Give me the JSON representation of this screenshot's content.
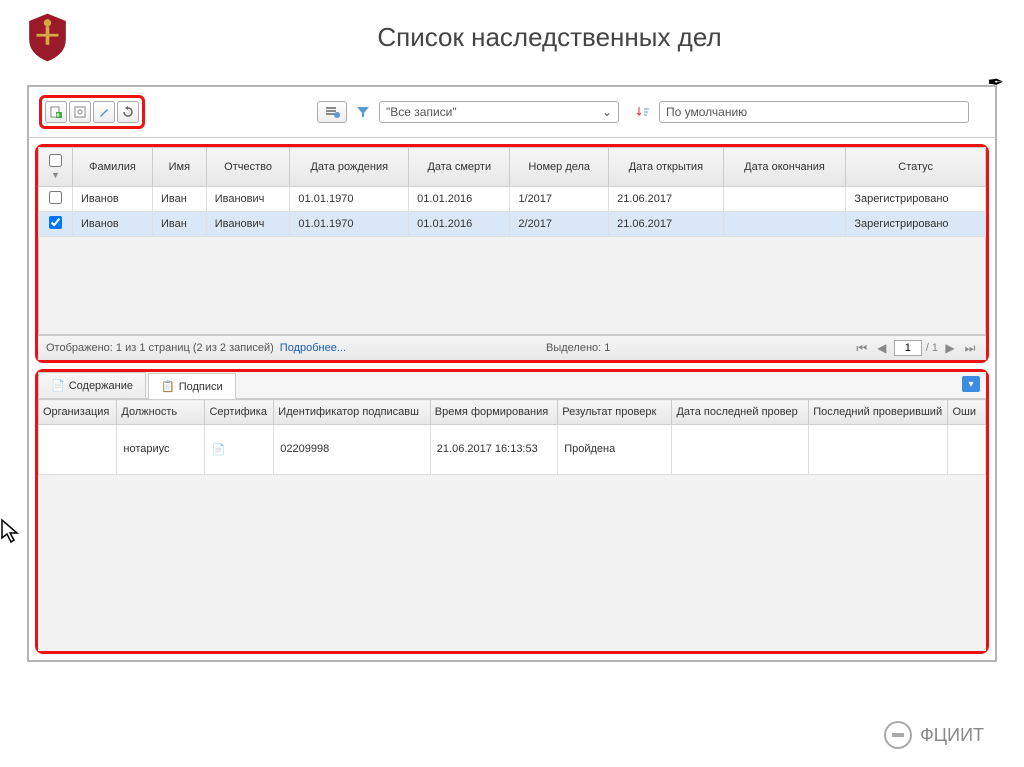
{
  "page_title": "Список наследственных дел",
  "toolbar": {
    "filter_label": "\"Все записи\"",
    "sort_label": "По умолчанию"
  },
  "columns": [
    "Фамилия",
    "Имя",
    "Отчество",
    "Дата рождения",
    "Дата смерти",
    "Номер дела",
    "Дата открытия",
    "Дата окончания",
    "Статус"
  ],
  "rows": [
    {
      "checked": false,
      "cells": [
        "Иванов",
        "Иван",
        "Иванович",
        "01.01.1970",
        "01.01.2016",
        "1/2017",
        "21.06.2017",
        "",
        "Зарегистрировано"
      ]
    },
    {
      "checked": true,
      "cells": [
        "Иванов",
        "Иван",
        "Иванович",
        "01.01.1970",
        "01.01.2016",
        "2/2017",
        "21.06.2017",
        "",
        "Зарегистрировано"
      ]
    }
  ],
  "status": {
    "shown": "Отображено: 1 из 1 страниц (2 из 2 записей)",
    "more": "Подробнее...",
    "selected": "Выделено:  1",
    "page": "1",
    "page_of": "/ 1"
  },
  "tabs": {
    "content": "Содержание",
    "signatures": "Подписи"
  },
  "sig_columns": [
    "Организация",
    "Должность",
    "Сертифика",
    "Идентификатор подписавш",
    "Время формирования",
    "Результат проверк",
    "Дата последней провер",
    "Последний проверивший",
    "Оши"
  ],
  "sig_rows": [
    {
      "org": "",
      "pos": "нотариус",
      "cert_icon": true,
      "id": "02209998",
      "time": "21.06.2017 16:13:53",
      "result": "Пройдена",
      "last_check": "",
      "checker": "",
      "err": ""
    }
  ],
  "footer": "ФЦИИТ"
}
